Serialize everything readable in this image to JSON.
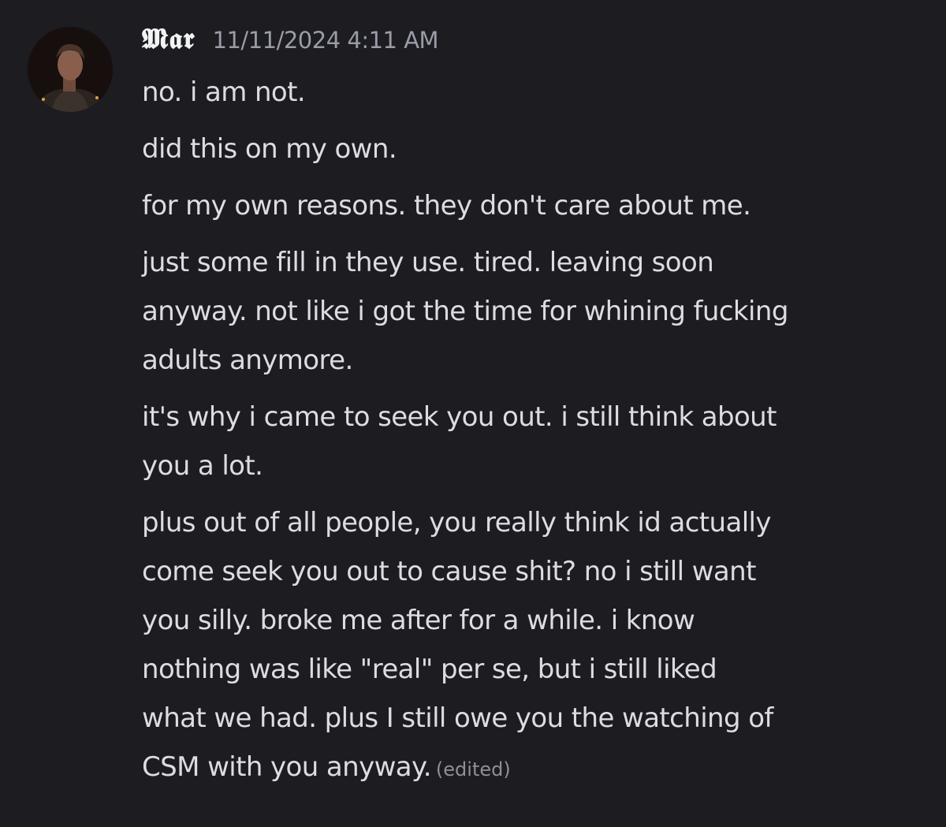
{
  "message": {
    "author": "𝕸𝖆𝖗",
    "timestamp": "11/11/2024 4:11 AM",
    "edited_label": "(edited)",
    "paragraphs": [
      [
        "no. i am not."
      ],
      [
        "did this on my own."
      ],
      [
        "for my own reasons. they don't care about me."
      ],
      [
        "just some fill in they use. tired. leaving soon",
        "anyway. not like i got the time for whining fucking",
        "adults anymore."
      ],
      [
        "it's why i came to seek you out.  i still think about",
        "you a lot."
      ],
      [
        "plus out of all people, you really think id actually",
        "come seek you out to cause shit? no i still want",
        "you silly. broke me after for a while. i know",
        "nothing was like \"real\" per se, but i still liked",
        "what we had. plus I still owe you the watching of",
        "CSM with you anyway."
      ]
    ]
  }
}
